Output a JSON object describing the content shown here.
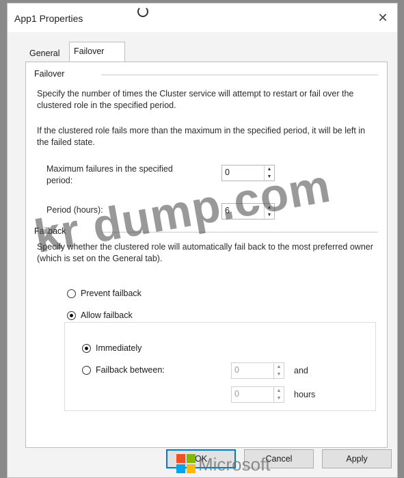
{
  "window": {
    "title": "App1 Properties",
    "close_glyph": "✕"
  },
  "tabs": [
    {
      "label": "General",
      "selected": false
    },
    {
      "label": "Failover",
      "selected": true
    }
  ],
  "failover": {
    "heading": "Failover",
    "description": "Specify the number of times the Cluster service will attempt to restart or fail over the clustered role in the specified period.",
    "note": "If the clustered role fails more than the maximum in the specified period, it will be left in the failed state.",
    "max_failures_label": "Maximum failures in the specified period:",
    "max_failures_value": "0",
    "period_label": "Period (hours):",
    "period_value": "6"
  },
  "failback": {
    "heading": "Failback",
    "description": "Specify whether the clustered role will automatically fail back to the most preferred owner (which is set on the General tab).",
    "prevent_label": "Prevent failback",
    "allow_label": "Allow failback",
    "selected": "allow",
    "immediately_label": "Immediately",
    "between_label": "Failback between:",
    "timing_selected": "immediately",
    "between_from_value": "0",
    "and_label": "and",
    "between_to_value": "0",
    "hours_label": "hours"
  },
  "buttons": {
    "ok": "OK",
    "cancel": "Cancel",
    "apply": "Apply"
  },
  "watermark": {
    "text": "kr dump.com",
    "brand": "Microsoft"
  },
  "colors": {
    "accent": "#0078d7",
    "ms_red": "#f25022",
    "ms_green": "#7fba00",
    "ms_blue": "#00a4ef",
    "ms_yellow": "#ffb900"
  }
}
